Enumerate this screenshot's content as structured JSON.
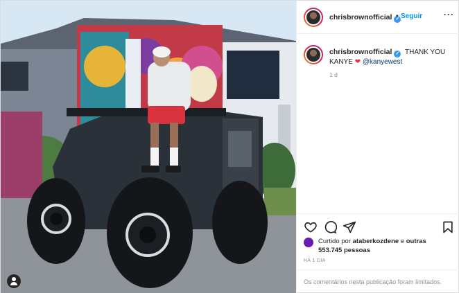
{
  "post": {
    "username": "chrisbrownofficial",
    "verified_symbol": "✓",
    "separator": "•",
    "follow_label": "Seguir",
    "more_label": "···",
    "caption_text": "THANK YOU KANYE",
    "caption_emoji": "❤",
    "caption_mention": "@kanyewest",
    "caption_time": "1 d",
    "likes_prefix": "Curtido por",
    "likes_user": "ataberkozdene",
    "likes_connector": "e",
    "likes_others": "outras 553.745 pessoas",
    "posted_when": "HÁ 1 DIA",
    "comments_notice": "Os comentários nesta publicação foram limitados."
  },
  "icons": {
    "like": "heart-outline-icon",
    "comment": "speech-bubble-icon",
    "share": "paper-plane-icon",
    "save": "bookmark-icon",
    "tag": "user-tag-icon",
    "more": "ellipsis-icon"
  },
  "colors": {
    "link_blue": "#0095f6",
    "verified_blue": "#3897f0",
    "mention": "#00376b",
    "muted": "#8e8e8e",
    "heart": "#ed2e3f"
  }
}
